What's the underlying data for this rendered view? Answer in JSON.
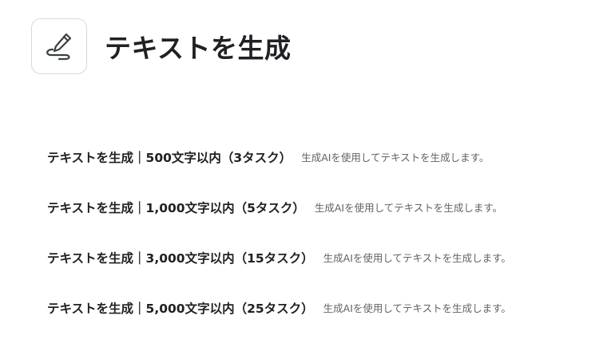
{
  "header": {
    "icon": "pen-icon",
    "title": "テキストを生成"
  },
  "options": [
    {
      "label": "テキストを生成｜500文字以内（3タスク）",
      "description": "生成AIを使用してテキストを生成します。"
    },
    {
      "label": "テキストを生成｜1,000文字以内（5タスク）",
      "description": "生成AIを使用してテキストを生成します。"
    },
    {
      "label": "テキストを生成｜3,000文字以内（15タスク）",
      "description": "生成AIを使用してテキストを生成します。"
    },
    {
      "label": "テキストを生成｜5,000文字以内（25タスク）",
      "description": "生成AIを使用してテキストを生成します。"
    }
  ]
}
